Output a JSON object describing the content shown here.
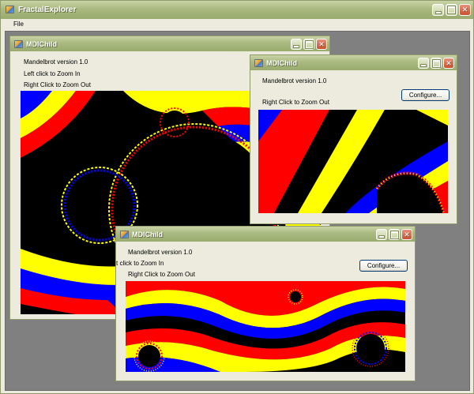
{
  "app": {
    "title": "FractalExplorer",
    "menu": [
      "File"
    ]
  },
  "windows": [
    {
      "title": "MDIChild",
      "version": "Mandelbrot version 1.0",
      "hint_left": "Left click to Zoom In",
      "hint_right": "Right Click to Zoom Out"
    },
    {
      "title": "MDIChild",
      "version": "Mandelbrot version 1.0",
      "hint_right": "Right Click to Zoom Out",
      "configure_label": "Configure..."
    },
    {
      "title": "MDIChild",
      "version": "Mandelbrot version 1.0",
      "hint_left": "t click to Zoom In",
      "hint_right": "Right Click to Zoom Out",
      "configure_label": "Configure..."
    }
  ],
  "colors": {
    "fractal_red": "#ff0000",
    "fractal_yellow": "#ffff00",
    "fractal_blue": "#0000ff",
    "fractal_black": "#000000",
    "mdi_background": "#808080",
    "window_face": "#ecebde",
    "titlebar": "#a9b980"
  },
  "icons": {
    "app": "app-icon",
    "minimize": "minimize-icon",
    "maximize": "maximize-icon",
    "close": "close-icon"
  }
}
